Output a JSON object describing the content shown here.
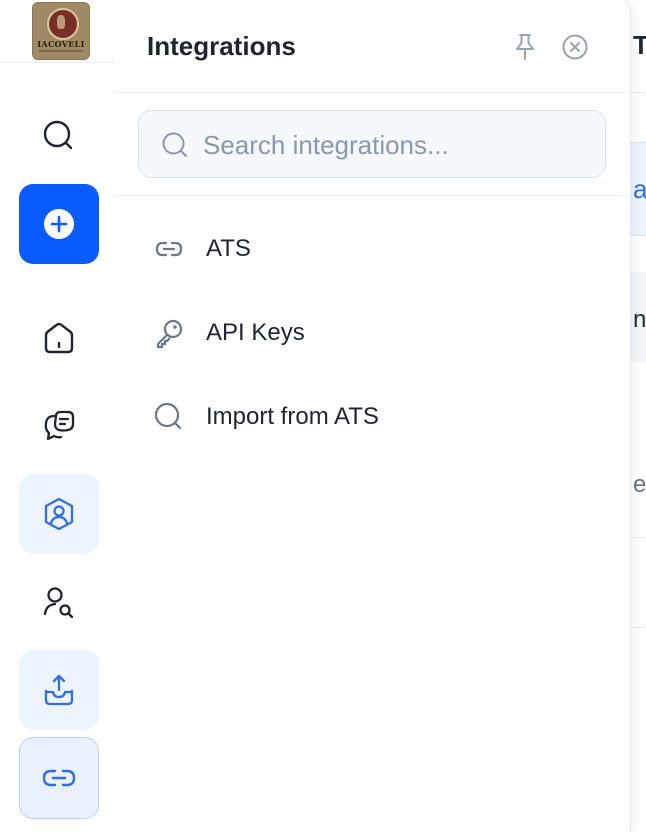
{
  "brand": {
    "logo_text": "IACOVELI",
    "icon": "winery-seal-logo"
  },
  "rail": {
    "items": [
      {
        "name": "search",
        "icon": "search-icon"
      },
      {
        "name": "create",
        "icon": "plus-circle-icon"
      },
      {
        "name": "home",
        "icon": "home-icon"
      },
      {
        "name": "messages",
        "icon": "chat-bubbles-icon"
      },
      {
        "name": "profile",
        "icon": "user-shield-icon"
      },
      {
        "name": "find-candidates",
        "icon": "user-search-icon"
      },
      {
        "name": "export",
        "icon": "inbox-upload-icon"
      },
      {
        "name": "integrations",
        "icon": "link-icon",
        "selected": true
      }
    ]
  },
  "panel": {
    "title": "Integrations",
    "pin_icon": "pin-icon",
    "close_icon": "close-circle-icon",
    "search": {
      "placeholder": "Search integrations...",
      "value": ""
    },
    "items": [
      {
        "label": "ATS",
        "icon": "link-icon"
      },
      {
        "label": "API Keys",
        "icon": "key-icon"
      },
      {
        "label": "Import from ATS",
        "icon": "search-icon"
      }
    ]
  },
  "background": {
    "glyphs": [
      "T",
      "a",
      "n",
      "es"
    ]
  },
  "colors": {
    "accent": "#0a5cff",
    "rail_active_bg": "#eaf1fd",
    "icon_blue": "#2f6fe0",
    "text": "#1f2430",
    "muted": "#8a98ad"
  }
}
